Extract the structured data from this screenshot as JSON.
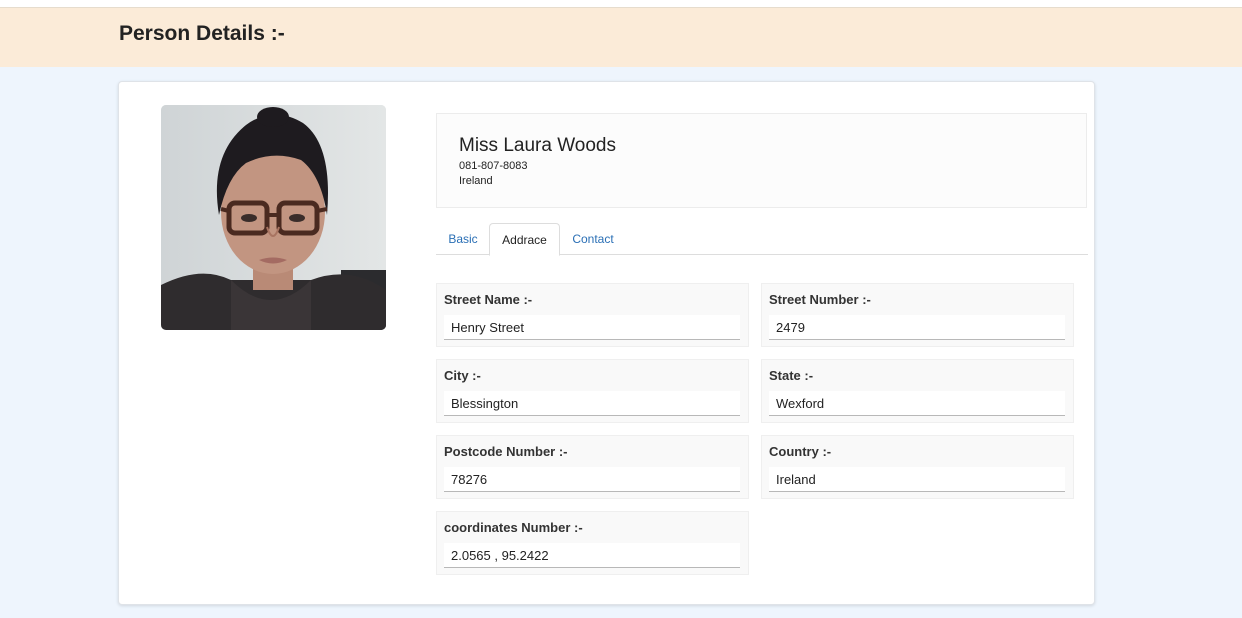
{
  "page": {
    "title": "Person Details :-"
  },
  "profile": {
    "name": "Miss Laura Woods",
    "phone": "081-807-8083",
    "country": "Ireland",
    "photo_icon": "person-photo"
  },
  "tabs": [
    {
      "label": "Basic",
      "active": false
    },
    {
      "label": "Addrace",
      "active": true
    },
    {
      "label": "Contact",
      "active": false
    }
  ],
  "address": {
    "street_name": {
      "label": "Street Name :-",
      "value": "Henry Street"
    },
    "street_number": {
      "label": "Street Number :-",
      "value": "2479"
    },
    "city": {
      "label": "City :-",
      "value": "Blessington"
    },
    "state": {
      "label": "State :-",
      "value": "Wexford"
    },
    "postcode": {
      "label": "Postcode Number :-",
      "value": "78276"
    },
    "country": {
      "label": "Country :-",
      "value": "Ireland"
    },
    "coordinates": {
      "label": "coordinates Number :-",
      "value": "2.0565 , 95.2422"
    }
  },
  "colors": {
    "header_bg": "#fbebd8",
    "page_bg": "#eef5fd",
    "link": "#2a6fb5"
  }
}
